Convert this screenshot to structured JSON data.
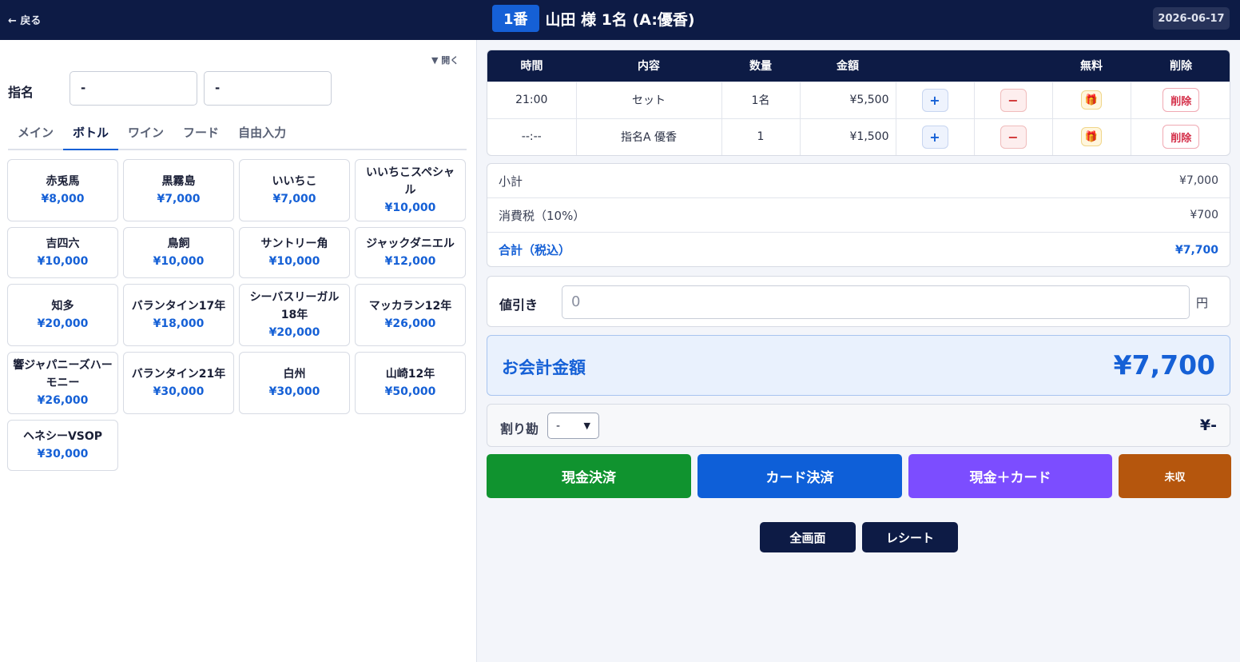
{
  "header": {
    "back_label": "← 戻る",
    "table_no": "1番",
    "guest": "山田 様 1名 (A:優香)",
    "date": "2026-06-17"
  },
  "left": {
    "toggle_label": "▼ 開く",
    "shimei_label": "指名",
    "shimei_values": [
      "-",
      "-"
    ],
    "tabs": [
      "メイン",
      "ボトル",
      "ワイン",
      "フード",
      "自由入力"
    ],
    "active_tab": "ボトル",
    "products": [
      {
        "name": "赤兎馬",
        "price": "¥8,000"
      },
      {
        "name": "黒霧島",
        "price": "¥7,000"
      },
      {
        "name": "いいちこ",
        "price": "¥7,000"
      },
      {
        "name": "いいちこスペシャル",
        "price": "¥10,000"
      },
      {
        "name": "吉四六",
        "price": "¥10,000"
      },
      {
        "name": "鳥飼",
        "price": "¥10,000"
      },
      {
        "name": "サントリー角",
        "price": "¥10,000"
      },
      {
        "name": "ジャックダニエル",
        "price": "¥12,000"
      },
      {
        "name": "知多",
        "price": "¥20,000"
      },
      {
        "name": "バランタイン17年",
        "price": "¥18,000"
      },
      {
        "name": "シーバスリーガル18年",
        "price": "¥20,000"
      },
      {
        "name": "マッカラン12年",
        "price": "¥26,000"
      },
      {
        "name": "響ジャパニーズハーモニー",
        "price": "¥26,000"
      },
      {
        "name": "バランタイン21年",
        "price": "¥30,000"
      },
      {
        "name": "白州",
        "price": "¥30,000"
      },
      {
        "name": "山崎12年",
        "price": "¥50,000"
      },
      {
        "name": "ヘネシーVSOP",
        "price": "¥30,000"
      }
    ]
  },
  "order": {
    "headers": {
      "time": "時間",
      "item": "内容",
      "qty": "数量",
      "amount": "金額",
      "free": "無料",
      "delete": "削除"
    },
    "plus_label": "+",
    "minus_label": "−",
    "free_icon": "🎁",
    "delete_label": "削除",
    "rows": [
      {
        "time": "21:00",
        "item": "セット",
        "qty": "1名",
        "amount": "¥5,500"
      },
      {
        "time": "--:--",
        "item": "指名A 優香",
        "qty": "1",
        "amount": "¥1,500"
      }
    ]
  },
  "summary": {
    "subtotal_label": "小計",
    "subtotal": "¥7,000",
    "tax_label": "消費税（10%）",
    "tax": "¥700",
    "total_label": "合計（税込）",
    "total": "¥7,700"
  },
  "discount": {
    "label": "値引き",
    "value": "0",
    "unit": "円"
  },
  "due": {
    "label": "お会計金額",
    "amount": "¥7,700"
  },
  "split": {
    "label": "割り勘",
    "selected": "-",
    "amount": "¥-"
  },
  "payments": {
    "cash": "現金決済",
    "card": "カード決済",
    "cash_card": "現金＋カード",
    "unpaid": "未収"
  },
  "footer": {
    "fullscreen": "全画面",
    "receipt": "レシート"
  },
  "colors": {
    "navy": "#0d1b45",
    "blue": "#1560d6",
    "cash": "#10932f",
    "card": "#0e5fd8",
    "cash_card": "#7c4dff",
    "unpaid": "#b5560d"
  }
}
